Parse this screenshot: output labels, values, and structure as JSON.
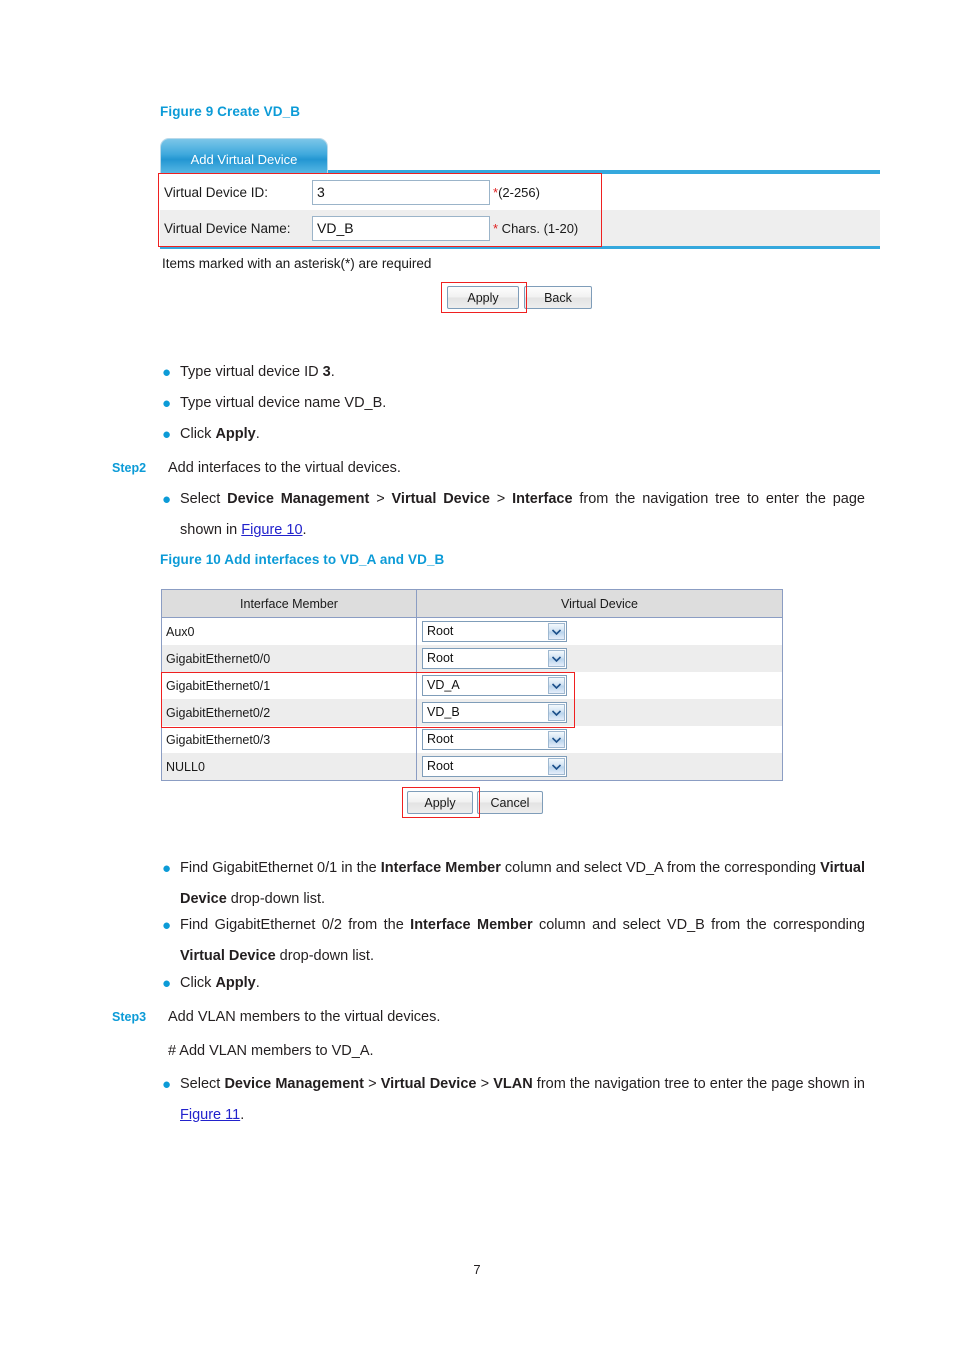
{
  "figure9": {
    "caption": "Figure 9 Create VD_B",
    "tab_label": "Add Virtual Device",
    "fields": [
      {
        "label": "Virtual Device ID:",
        "value": "3",
        "hint_ast": "*",
        "hint": "(2-256)"
      },
      {
        "label": "Virtual Device Name:",
        "value": "VD_B",
        "hint_ast": "*",
        "hint": " Chars. (1-20)"
      }
    ],
    "note": "Items marked with an asterisk(*) are required",
    "apply_label": "Apply",
    "back_label": "Back"
  },
  "bullets_after_fig9": [
    {
      "pre": "Type virtual device ID ",
      "bold": "3",
      "post": "."
    },
    {
      "pre": "Type virtual device name VD_B.",
      "bold": "",
      "post": ""
    },
    {
      "pre": "Click ",
      "bold": "Apply",
      "post": "."
    }
  ],
  "step2": {
    "label": "Step2",
    "text": "Add interfaces to the virtual devices.",
    "bullet": {
      "p1": "Select ",
      "b1": "Device Management",
      "p2": " > ",
      "b2": "Virtual Device",
      "p3": " > ",
      "b3": "Interface",
      "p4": " from the navigation tree to enter the page shown in ",
      "link": "Figure 10",
      "p5": "."
    }
  },
  "figure10": {
    "caption": "Figure 10 Add interfaces to VD_A and VD_B",
    "columns": [
      "Interface Member",
      "Virtual Device"
    ],
    "rows": [
      {
        "interface": "Aux0",
        "virtual_device": "Root"
      },
      {
        "interface": "GigabitEthernet0/0",
        "virtual_device": "Root"
      },
      {
        "interface": "GigabitEthernet0/1",
        "virtual_device": "VD_A"
      },
      {
        "interface": "GigabitEthernet0/2",
        "virtual_device": "VD_B"
      },
      {
        "interface": "GigabitEthernet0/3",
        "virtual_device": "Root"
      },
      {
        "interface": "NULL0",
        "virtual_device": "Root"
      }
    ],
    "apply_label": "Apply",
    "cancel_label": "Cancel"
  },
  "bullets_after_fig10": [
    {
      "p1": "Find GigabitEthernet 0/1 in the ",
      "b1": "Interface Member",
      "p2": " column and select VD_A from the corresponding ",
      "b2": "Virtual Device",
      "p3": " drop-down list."
    },
    {
      "p1": "Find GigabitEthernet 0/2 from the ",
      "b1": "Interface Member",
      "p2": " column and select VD_B from the corresponding ",
      "b2": "Virtual Device",
      "p3": " drop-down list."
    }
  ],
  "click_apply": {
    "pre": "Click ",
    "bold": "Apply",
    "post": "."
  },
  "step3": {
    "label": "Step3",
    "text": "Add VLAN members to the virtual devices.",
    "note": "# Add VLAN members to VD_A.",
    "bullet": {
      "p1": "Select ",
      "b1": "Device Management",
      "p2": " > ",
      "b2": "Virtual Device",
      "p3": " > ",
      "b3": "VLAN",
      "p4": " from the navigation tree to enter the page shown in ",
      "link": "Figure 11",
      "p5": "."
    }
  },
  "page_number": "7",
  "colors": {
    "accent_blue": "#0c9bd7",
    "highlight_red": "#ef2020",
    "link_blue": "#2222cc",
    "tab_blue": "#35a8dd"
  }
}
